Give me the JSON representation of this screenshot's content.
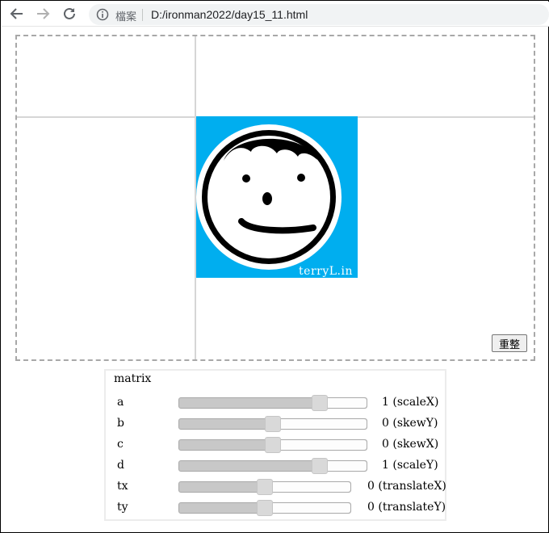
{
  "browser": {
    "protocol_label": "檔案",
    "url": "D:/ironman2022/day15_11.html"
  },
  "canvas": {
    "image_signature": "terryL.in",
    "reset_label": "重整"
  },
  "matrix": {
    "title": "matrix",
    "rows": [
      {
        "label": "a",
        "value": "1",
        "desc": "(scaleX)",
        "slider_fraction": 0.75
      },
      {
        "label": "b",
        "value": "0",
        "desc": "(skewY)",
        "slider_fraction": 0.5
      },
      {
        "label": "c",
        "value": "0",
        "desc": "(skewX)",
        "slider_fraction": 0.5
      },
      {
        "label": "d",
        "value": "1",
        "desc": "(scaleY)",
        "slider_fraction": 0.75
      },
      {
        "label": "tx",
        "value": "0",
        "desc": "(translateX)",
        "slider_fraction": 0.5
      },
      {
        "label": "ty",
        "value": "0",
        "desc": "(translateY)",
        "slider_fraction": 0.5
      }
    ]
  },
  "colors": {
    "image_background": "#00aeef",
    "slider_track": "#c8c8c8",
    "canvas_border": "#a8a8a8"
  }
}
